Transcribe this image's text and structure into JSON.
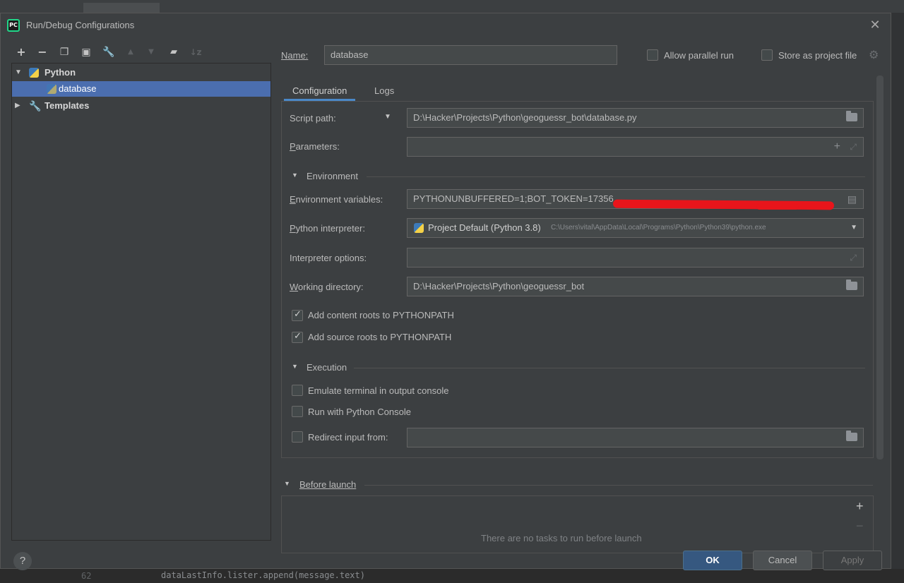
{
  "window": {
    "title": "Run/Debug Configurations",
    "app_icon_text": "PC"
  },
  "toolbar": {
    "icons": [
      "add-icon",
      "remove-icon",
      "copy-icon",
      "save-icon",
      "wrench-icon",
      "move-up-icon",
      "move-down-icon",
      "folder-icon",
      "sort-icon"
    ]
  },
  "tree": {
    "python_label": "Python",
    "database_label": "database",
    "templates_label": "Templates"
  },
  "form": {
    "name_label": "Name:",
    "name_value": "database",
    "allow_parallel_label": "Allow parallel run",
    "store_project_label": "Store as project file",
    "tabs": [
      "Configuration",
      "Logs"
    ],
    "script_path_label": "Script path:",
    "script_path_value": "D:\\Hacker\\Projects\\Python\\geoguessr_bot\\database.py",
    "parameters_label": "Parameters:",
    "parameters_value": "",
    "environment_section": "Environment",
    "env_vars_label": "Environment variables:",
    "env_vars_value": "PYTHONUNBUFFERED=1;BOT_TOKEN=17356",
    "interpreter_label": "Python interpreter:",
    "interpreter_value": "Project Default (Python 3.8)",
    "interpreter_path": "C:\\Users\\vital\\AppData\\Local\\Programs\\Python\\Python39\\python.exe",
    "interp_options_label": "Interpreter options:",
    "interp_options_value": "",
    "working_dir_label": "Working directory:",
    "working_dir_value": "D:\\Hacker\\Projects\\Python\\geoguessr_bot",
    "content_roots_label": "Add content roots to PYTHONPATH",
    "source_roots_label": "Add source roots to PYTHONPATH",
    "execution_section": "Execution",
    "emulate_terminal_label": "Emulate terminal in output console",
    "python_console_label": "Run with Python Console",
    "redirect_input_label": "Redirect input from:",
    "redirect_input_value": ""
  },
  "before_launch": {
    "label": "Before launch",
    "empty_text": "There are no tasks to run before launch"
  },
  "buttons": {
    "ok": "OK",
    "cancel": "Cancel",
    "apply": "Apply",
    "help": "?"
  },
  "background": {
    "gutter": "62",
    "code": "dataLastInfo.lister.append(message.text)"
  },
  "colors": {
    "selection": "#4b6eaf",
    "primary_button": "#365880",
    "tab_underline": "#4a88c7",
    "redaction": "#e8151b"
  }
}
